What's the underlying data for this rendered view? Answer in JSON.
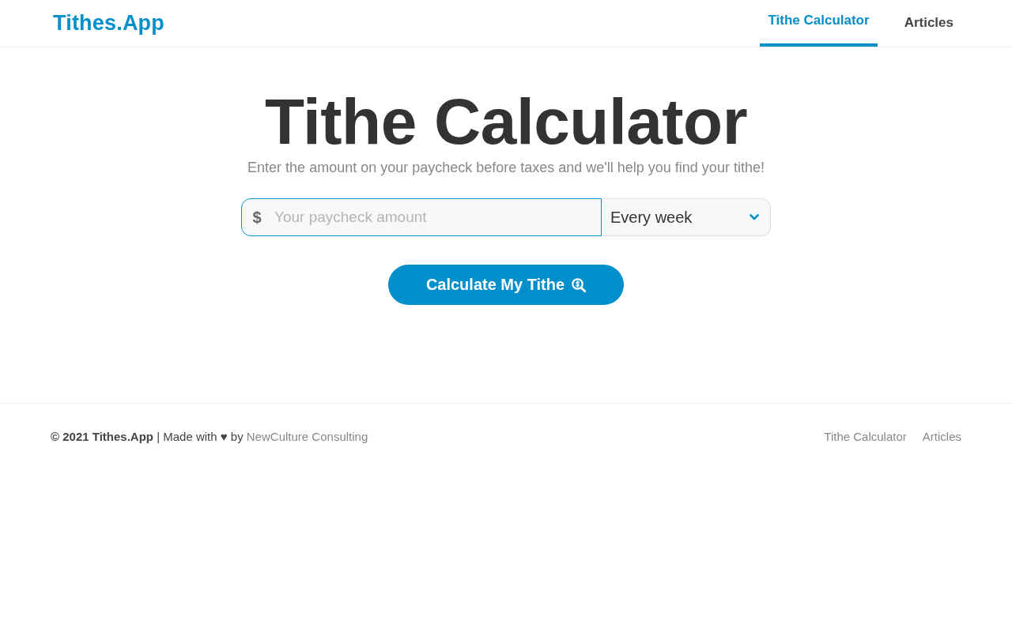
{
  "header": {
    "logo": "Tithes.App",
    "nav": [
      {
        "label": "Tithe Calculator",
        "selected": true
      },
      {
        "label": "Articles",
        "selected": false
      }
    ]
  },
  "main": {
    "title": "Tithe Calculator",
    "subtitle": "Enter the amount on your paycheck before taxes and we'll help you find your tithe!",
    "amount_field": {
      "prefix": "$",
      "placeholder": "Your paycheck amount"
    },
    "frequency_select": {
      "value": "Every week"
    },
    "submit_button": {
      "label": "Calculate My Tithe"
    }
  },
  "footer": {
    "text": "**© 2021 Tithes.App** | Made with ♥ by",
    "credit_link": "NewCulture Consulting",
    "links": [
      "Tithe Calculator",
      "Articles"
    ]
  }
}
